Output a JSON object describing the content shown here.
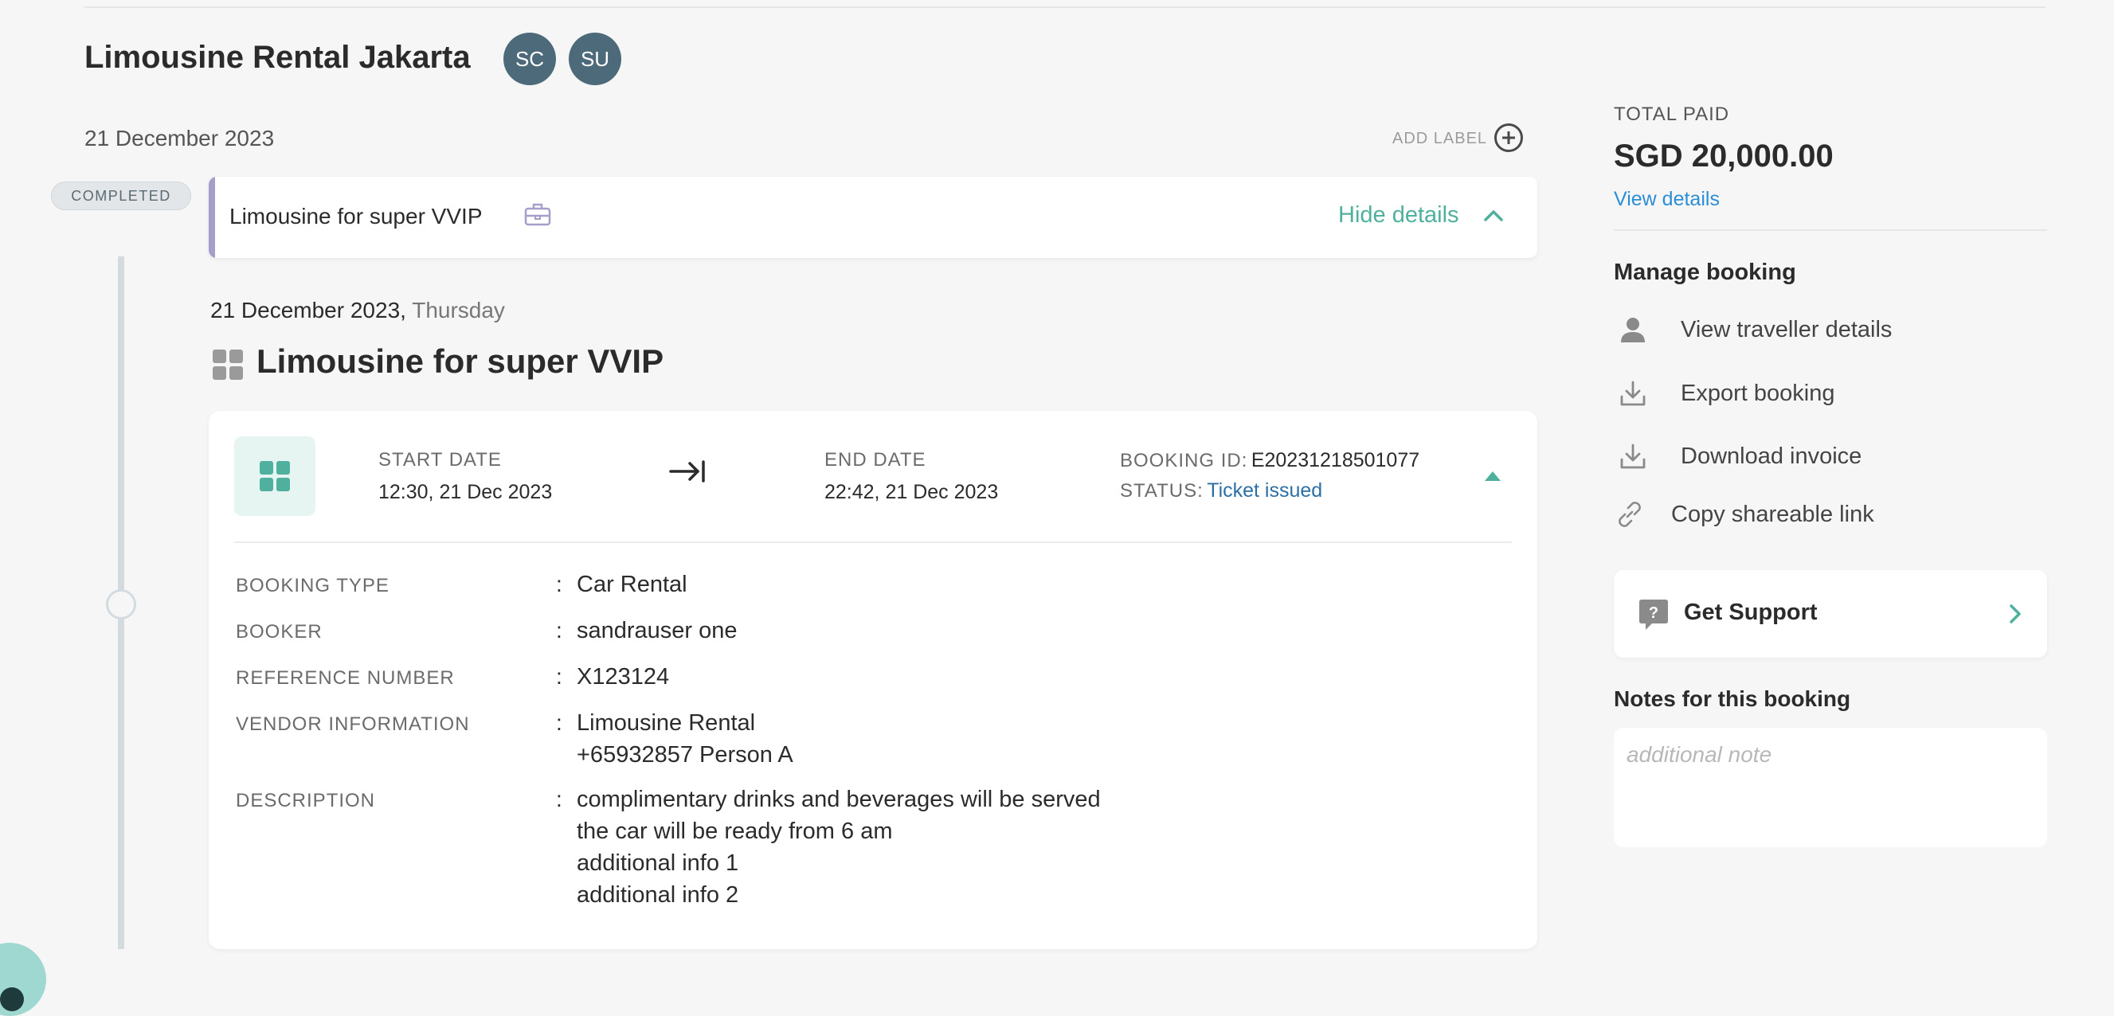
{
  "booking": {
    "title": "Limousine Rental Jakarta",
    "avatars": [
      "SC",
      "SU"
    ],
    "date": "21 December 2023",
    "add_label": "ADD LABEL",
    "status_badge": "COMPLETED"
  },
  "item": {
    "name": "Limousine for super VVIP",
    "toggle_label": "Hide details",
    "day_date": "21 December 2023,",
    "day_weekday": "Thursday",
    "section_title": "Limousine for super VVIP"
  },
  "summary": {
    "start_label": "START DATE",
    "start_value": "12:30, 21 Dec 2023",
    "end_label": "END DATE",
    "end_value": "22:42, 21 Dec 2023",
    "booking_id_label": "BOOKING ID:",
    "booking_id": "E20231218501077",
    "status_label": "STATUS:",
    "status_value": "Ticket issued"
  },
  "details": [
    {
      "label": "BOOKING TYPE",
      "value": [
        "Car Rental"
      ]
    },
    {
      "label": "BOOKER",
      "value": [
        "sandrauser one"
      ]
    },
    {
      "label": "REFERENCE NUMBER",
      "value": [
        "X123124"
      ]
    },
    {
      "label": "VENDOR INFORMATION",
      "value": [
        "Limousine Rental",
        "+65932857 Person A"
      ]
    },
    {
      "label": "DESCRIPTION",
      "value": [
        "complimentary drinks and beverages will be served",
        "the car will be ready from 6 am",
        "additional info 1",
        "additional info 2"
      ]
    }
  ],
  "sidebar": {
    "total_label": "TOTAL PAID",
    "total_value": "SGD 20,000.00",
    "view_details": "View details",
    "manage_title": "Manage booking",
    "menu": [
      {
        "label": "View traveller details",
        "icon": "person-icon"
      },
      {
        "label": "Export booking",
        "icon": "download-icon"
      },
      {
        "label": "Download invoice",
        "icon": "download-icon"
      },
      {
        "label": "Copy shareable link",
        "icon": "link-icon"
      }
    ],
    "support_label": "Get Support",
    "notes_title": "Notes for this booking",
    "notes_placeholder": "additional note",
    "notes_value": ""
  },
  "colors": {
    "accent_teal": "#4fb09e",
    "accent_purple": "#a79ecb",
    "link_blue": "#2c8ed6",
    "avatar_bg": "#4d6a7a"
  }
}
